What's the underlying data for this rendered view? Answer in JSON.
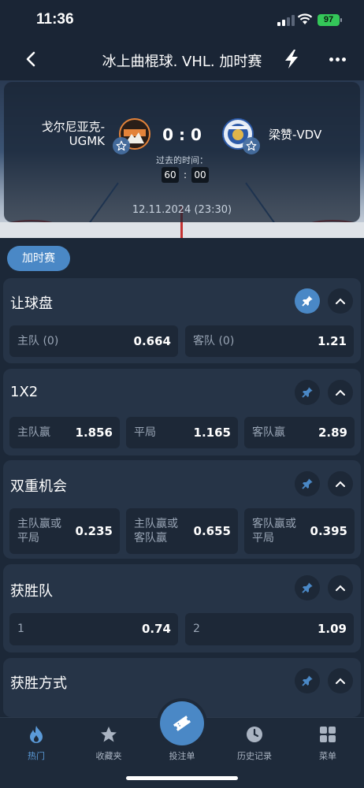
{
  "status_bar": {
    "time": "11:36",
    "battery": "97"
  },
  "nav": {
    "title": "冰上曲棍球. VHL. 加时赛"
  },
  "match": {
    "home_team": "戈尔尼亚克-UGMK",
    "away_team": "梁赞-VDV",
    "score": "0 : 0",
    "elapsed_label": "过去的时间：",
    "elapsed_minutes": "60",
    "elapsed_seconds": "00",
    "date": "12.11.2024 (23:30)"
  },
  "filter": {
    "label": "加时赛"
  },
  "markets": [
    {
      "title": "让球盘",
      "pinned": true,
      "odds": [
        {
          "label": "主队 (0)",
          "value": "0.664"
        },
        {
          "label": "客队 (0)",
          "value": "1.21"
        }
      ]
    },
    {
      "title": "1X2",
      "pinned": false,
      "odds": [
        {
          "label": "主队赢",
          "value": "1.856"
        },
        {
          "label": "平局",
          "value": "1.165"
        },
        {
          "label": "客队赢",
          "value": "2.89"
        }
      ]
    },
    {
      "title": "双重机会",
      "pinned": false,
      "odds": [
        {
          "label1": "主队赢或",
          "label2": "平局",
          "value": "0.235"
        },
        {
          "label1": "主队赢或",
          "label2": "客队赢",
          "value": "0.655"
        },
        {
          "label1": "客队赢或",
          "label2": "平局",
          "value": "0.395"
        }
      ]
    },
    {
      "title": "获胜队",
      "pinned": false,
      "odds": [
        {
          "label": "1",
          "value": "0.74"
        },
        {
          "label": "2",
          "value": "1.09"
        }
      ]
    },
    {
      "title": "获胜方式",
      "pinned": false,
      "odds": []
    }
  ],
  "tabs": [
    {
      "label": "热门",
      "icon": "flame-icon",
      "active": true
    },
    {
      "label": "收藏夹",
      "icon": "star-icon",
      "active": false
    },
    {
      "label": "投注单",
      "icon": "ticket-icon",
      "active": false
    },
    {
      "label": "历史记录",
      "icon": "clock-icon",
      "active": false
    },
    {
      "label": "菜单",
      "icon": "grid-icon",
      "active": false
    }
  ],
  "colors": {
    "accent": "#4a88c6",
    "background": "#1c2838",
    "card": "#263447",
    "button": "#1d2837"
  }
}
